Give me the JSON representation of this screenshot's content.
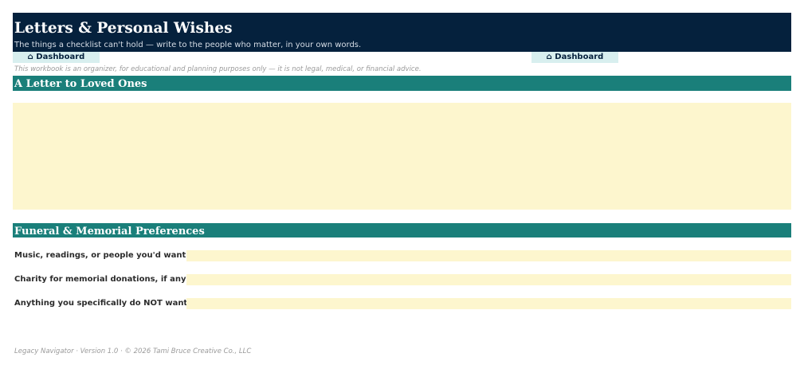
{
  "header": {
    "title": "Letters & Personal Wishes",
    "subtitle": "The things a checklist can't hold — write to the people who matter, in your own words."
  },
  "nav": {
    "dashboard_left": "⌂ Dashboard",
    "dashboard_right": "⌂ Dashboard"
  },
  "disclaimer": "This workbook is an organizer, for educational and planning purposes only — it is not legal, medical, or financial advice.",
  "letter_section": {
    "title": "A Letter to Loved Ones",
    "value": ""
  },
  "funeral_section": {
    "title": "Funeral & Memorial Preferences",
    "rows": [
      {
        "label": "Music, readings, or people you'd want",
        "value": ""
      },
      {
        "label": "Charity for memorial donations, if any",
        "value": ""
      },
      {
        "label": "Anything you specifically do NOT want",
        "value": ""
      }
    ]
  },
  "footer": "Legacy Navigator · Version 1.0 · © 2026 Tami Bruce Creative Co., LLC",
  "colors": {
    "header_bg": "#05213d",
    "section_bg": "#1a7f7a",
    "input_bg": "#fdf6ce",
    "button_bg": "#d8efef"
  }
}
